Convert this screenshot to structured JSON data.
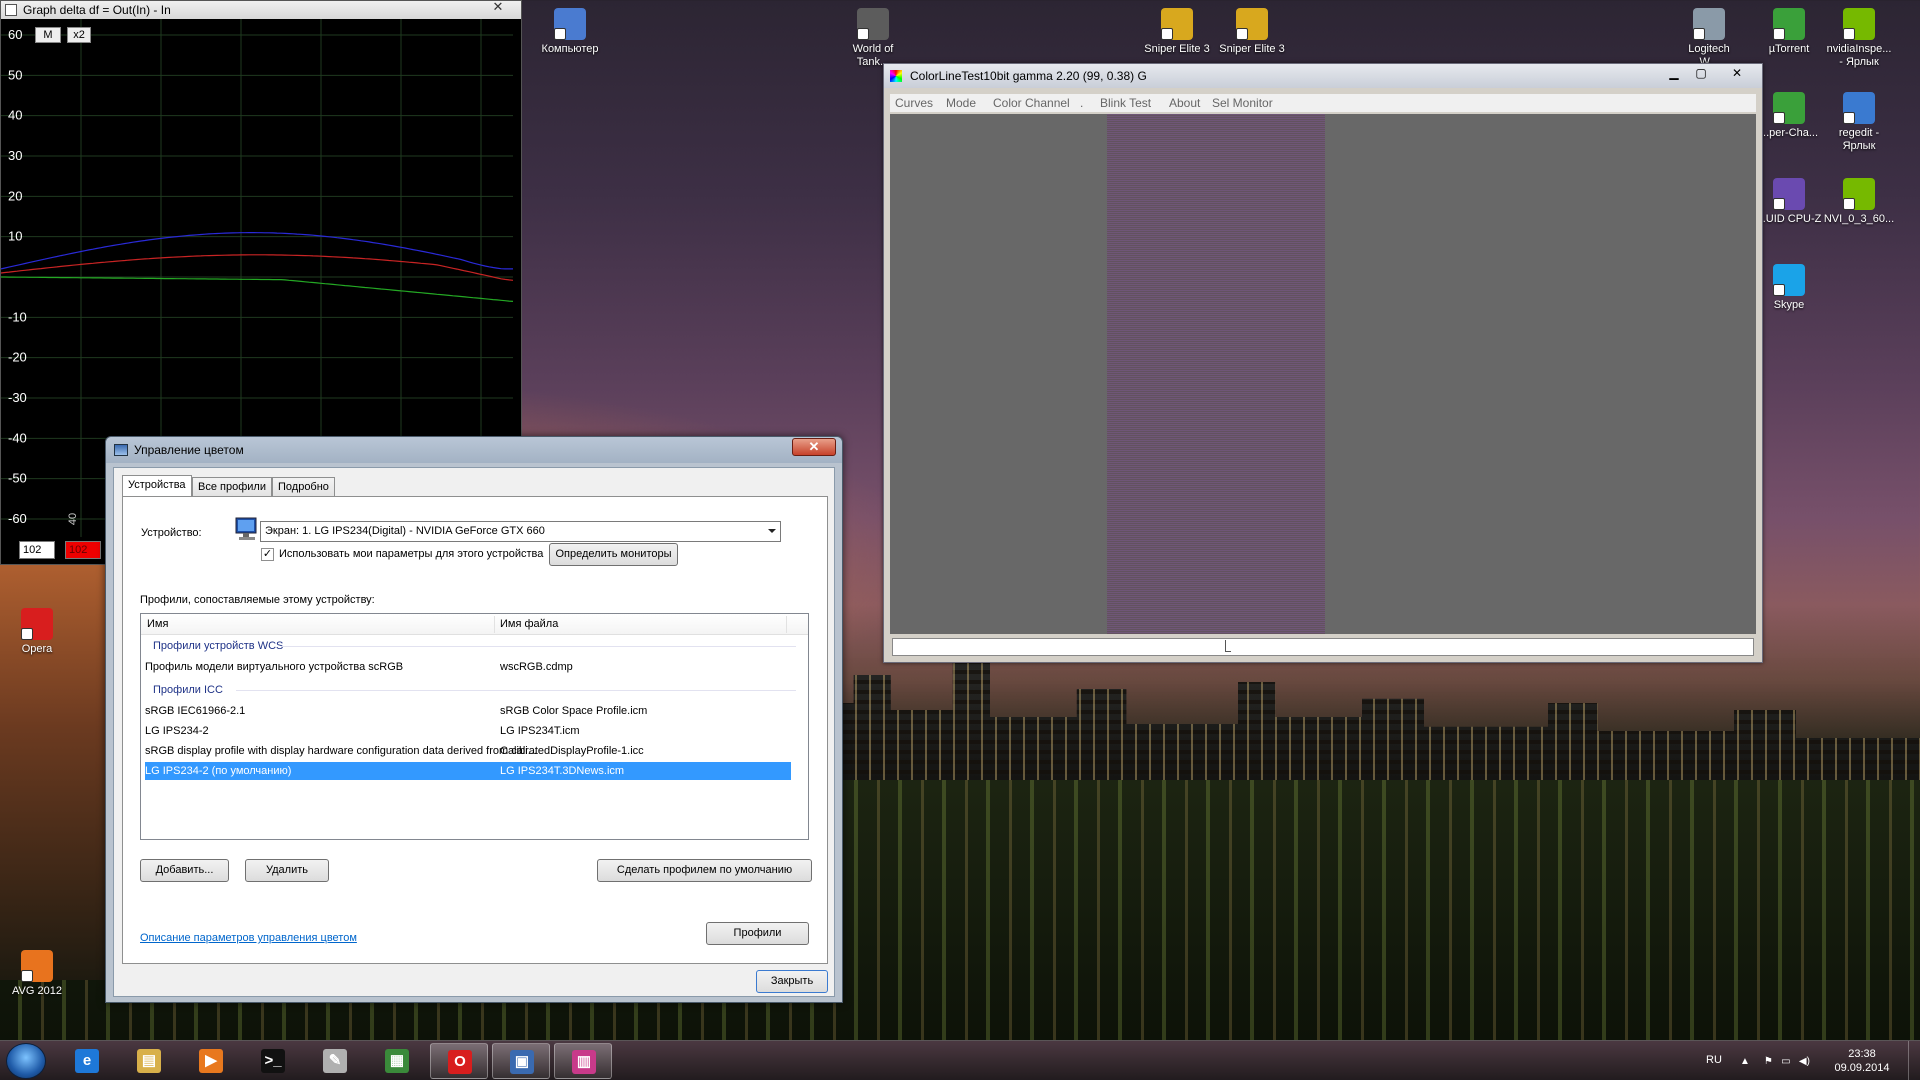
{
  "desktop": {
    "icons": [
      {
        "label": "Компьютер",
        "icon": "computer-icon",
        "color": "#4a7bd0"
      },
      {
        "label": "World of\nTank...",
        "icon": "world-of-tanks-icon",
        "color": "#5c5c5c"
      },
      {
        "label": "Sniper Elite 3\n...",
        "icon": "sniper-elite-icon",
        "color": "#d8a81e"
      },
      {
        "label": "Sniper Elite 3",
        "icon": "sniper-elite-icon",
        "color": "#d8a81e"
      },
      {
        "label": "Logitech\nW...",
        "icon": "logitech-icon",
        "color": "#8a9aa8"
      },
      {
        "label": "µTorrent",
        "icon": "utorrent-icon",
        "color": "#3aa03a"
      },
      {
        "label": "nvidiaInspe...\n- Ярлык",
        "icon": "nvidia-icon",
        "color": "#76b900"
      },
      {
        "label": "...per-Cha...",
        "icon": "app-icon",
        "color": "#3aa03a"
      },
      {
        "label": "regedit -\nЯрлык",
        "icon": "regedit-icon",
        "color": "#3a7ad0"
      },
      {
        "label": "...UID CPU-Z",
        "icon": "cpuz-icon",
        "color": "#6a4ab0"
      },
      {
        "label": "NVI_0_3_60...",
        "icon": "nvidia-icon",
        "color": "#76b900"
      },
      {
        "label": "Skype",
        "icon": "skype-icon",
        "color": "#1aa3e8"
      },
      {
        "label": "Opera",
        "icon": "opera-icon",
        "color": "#d81e1e"
      },
      {
        "label": "AVG 2012",
        "icon": "avg-icon",
        "color": "#e8731e"
      }
    ]
  },
  "graph_window": {
    "title": "Graph delta df = Out(In) - In",
    "close": "✕",
    "buttons": [
      "M",
      "x2"
    ],
    "yticks": [
      "60",
      "50",
      "40",
      "30",
      "20",
      "10",
      "",
      "-10",
      "-20",
      "-30",
      "-40",
      "-50",
      "-60"
    ],
    "side_label": "40",
    "spin_value": "102",
    "spin_value_red": "102",
    "colors": {
      "blue": "#2a2ad8",
      "red": "#c82424",
      "green": "#24a824",
      "grid": "#1f3a1f"
    }
  },
  "colorline": {
    "title": "ColorLineTest10bit gamma 2.20 (99, 0.38)   G",
    "controls": {
      "min": "▁",
      "max": "▢",
      "close": "✕"
    },
    "menu": [
      "Curves",
      "Mode",
      "Color Channel",
      ".",
      "Blink Test",
      "About",
      "Sel Monitor"
    ]
  },
  "dialog": {
    "title": "Управление цветом",
    "close": "✕",
    "tabs": [
      "Устройства",
      "Все профили",
      "Подробно"
    ],
    "device_label": "Устройство:",
    "device_value": "Экран: 1. LG IPS234(Digital) - NVIDIA GeForce GTX 660",
    "checkbox_checked": "✓",
    "checkbox_label": "Использовать мои параметры для этого устройства",
    "detect_button": "Определить мониторы",
    "profiles_label": "Профили, сопоставляемые этому устройству:",
    "columns": [
      "Имя",
      "Имя файла"
    ],
    "groups": [
      "Профили устройств WCS",
      "Профили ICC"
    ],
    "wcs_rows": [
      {
        "name": "Профиль модели виртуального устройства scRGB",
        "file": "wscRGB.cdmp"
      }
    ],
    "icc_rows": [
      {
        "name": "sRGB IEC61966-2.1",
        "file": "sRGB Color Space Profile.icm"
      },
      {
        "name": "LG IPS234-2",
        "file": "LG IPS234T.icm"
      },
      {
        "name": "sRGB display profile with display hardware configuration data derived from cali...",
        "file": "CalibratedDisplayProfile-1.icc"
      },
      {
        "name": "LG IPS234-2 (по умолчанию)",
        "file": "LG IPS234T.3DNews.icm"
      }
    ],
    "add_button": "Добавить...",
    "remove_button": "Удалить",
    "default_button": "Сделать профилем по умолчанию",
    "link": "Описание параметров управления цветом",
    "profiles_button": "Профили",
    "close_button": "Закрыть"
  },
  "taskbar": {
    "apps": [
      {
        "icon": "internet-explorer-icon",
        "glyph": "e",
        "color": "#1e78d8"
      },
      {
        "icon": "explorer-folder-icon",
        "glyph": "▤",
        "color": "#d8b04a"
      },
      {
        "icon": "media-player-icon",
        "glyph": "▶",
        "color": "#e8781e"
      },
      {
        "icon": "cmd-icon",
        "glyph": ">_",
        "color": "#111111"
      },
      {
        "icon": "paint-icon",
        "glyph": "✎",
        "color": "#b0b0b0"
      },
      {
        "icon": "graph-app-icon",
        "glyph": "▦",
        "color": "#3a8a3a"
      },
      {
        "icon": "opera-icon",
        "glyph": "O",
        "color": "#d81e1e"
      },
      {
        "icon": "color-management-icon",
        "glyph": "▣",
        "color": "#3a6ab0"
      },
      {
        "icon": "colorline-icon",
        "glyph": "▥",
        "color": "#c83a8a"
      }
    ],
    "active": [
      6,
      7,
      8
    ],
    "lang": "RU",
    "time": "23:38",
    "date": "09.09.2014"
  }
}
